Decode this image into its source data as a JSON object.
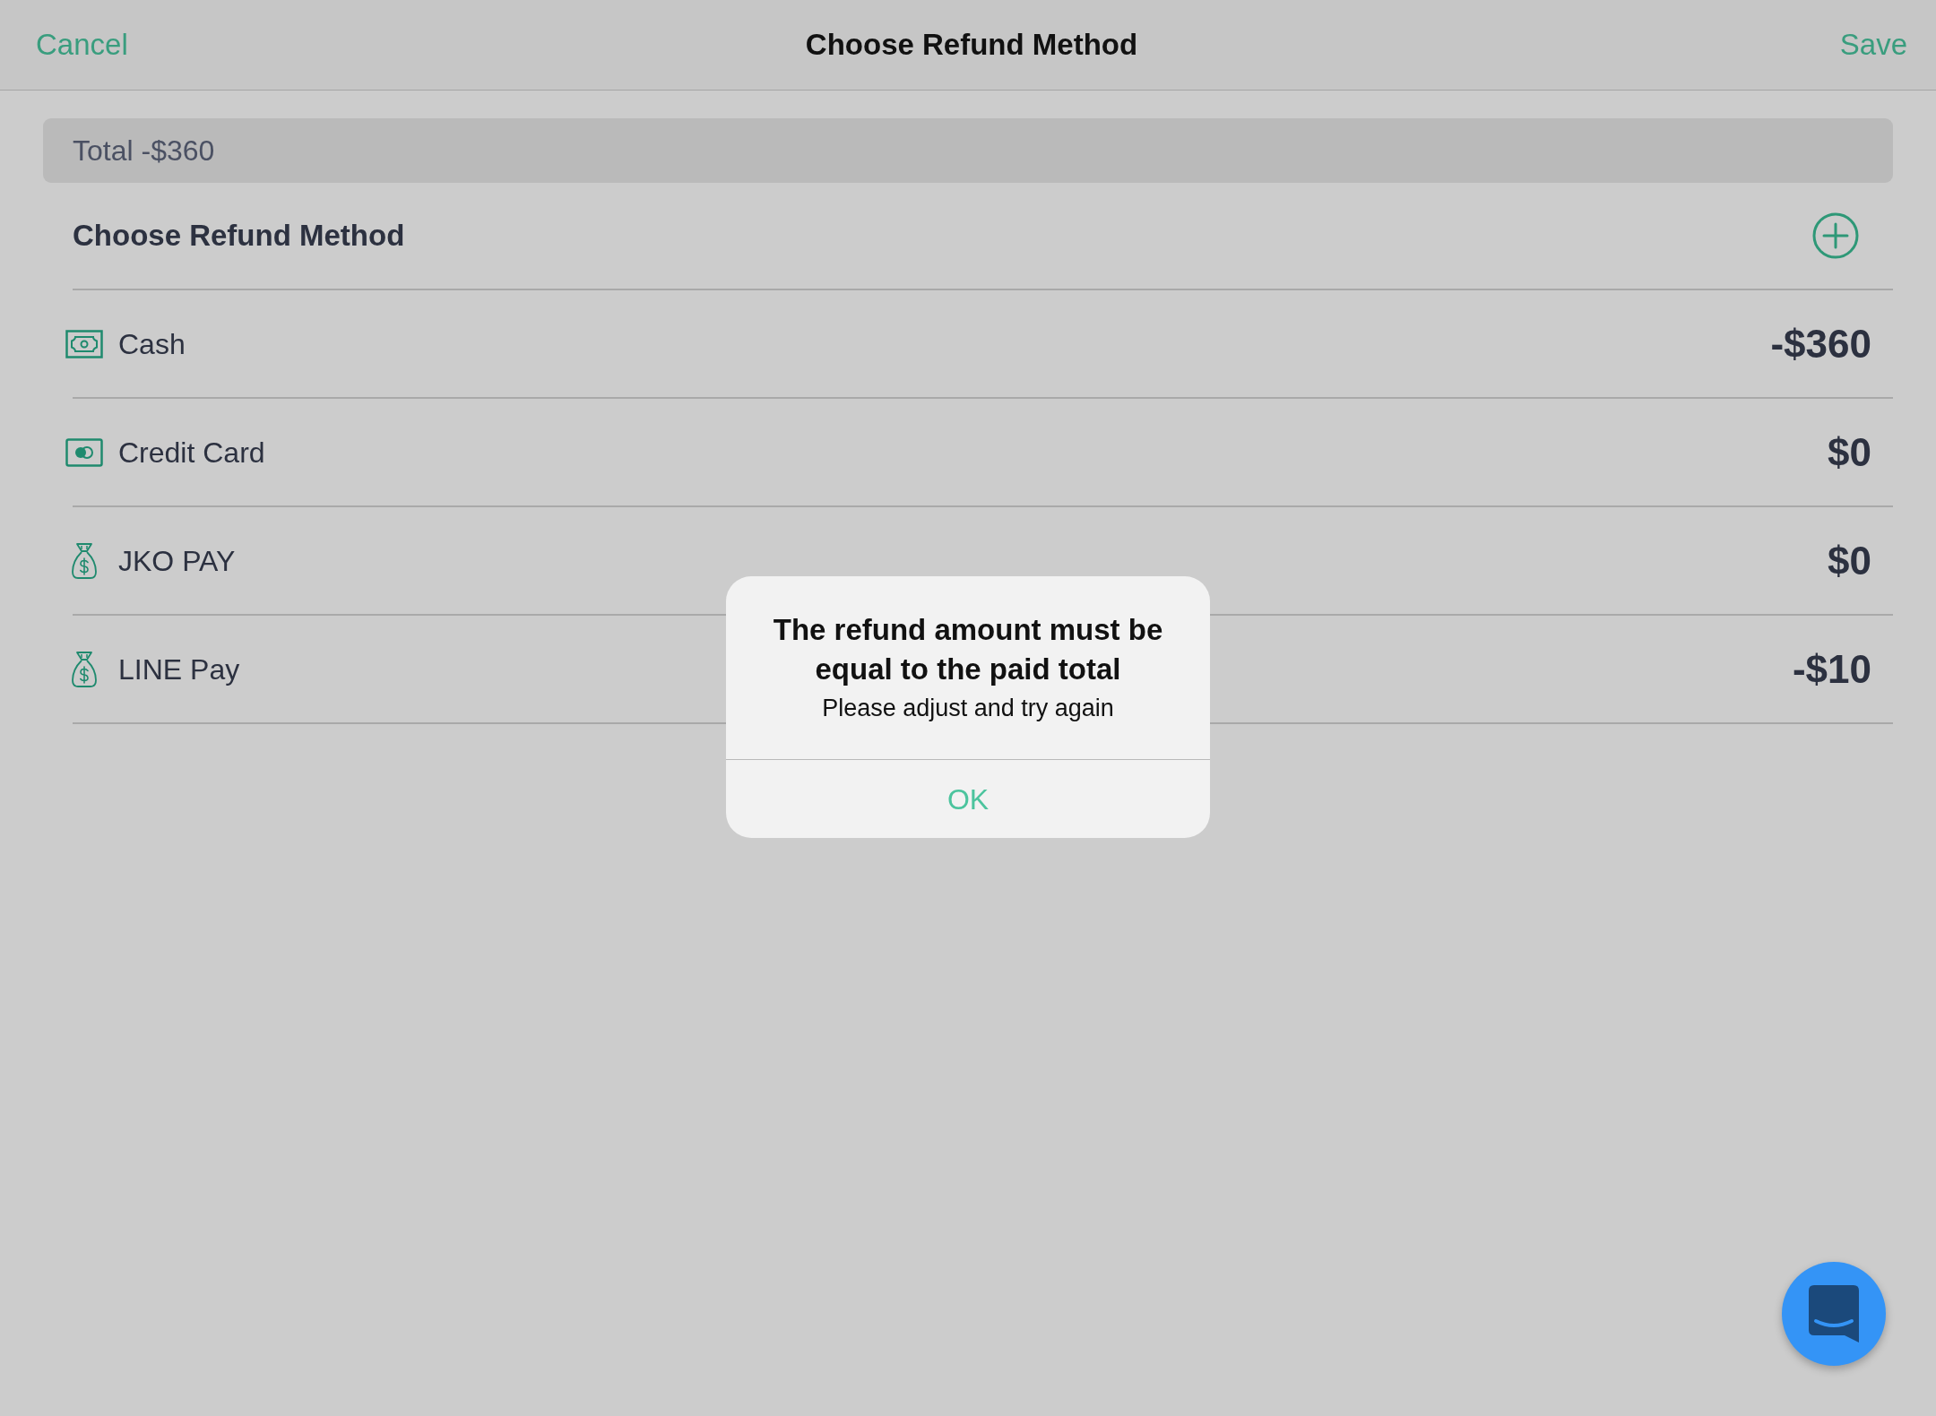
{
  "nav_bar": {
    "cancel": "Cancel",
    "title": "Choose Refund Method",
    "save": "Save"
  },
  "total": "Total -$360",
  "section": {
    "title": "Choose Refund Method"
  },
  "methods": [
    {
      "kind": "cash",
      "name": "Cash",
      "amount": "-$360"
    },
    {
      "kind": "card",
      "name": "Credit Card",
      "amount": "$0"
    },
    {
      "kind": "bag",
      "name": "JKO PAY",
      "amount": "$0"
    },
    {
      "kind": "bag",
      "name": "LINE Pay",
      "amount": "-$10"
    }
  ],
  "alert": {
    "title": "The refund amount must be equal to the paid total",
    "message": "Please adjust and try again",
    "buttons": [
      "OK"
    ]
  }
}
